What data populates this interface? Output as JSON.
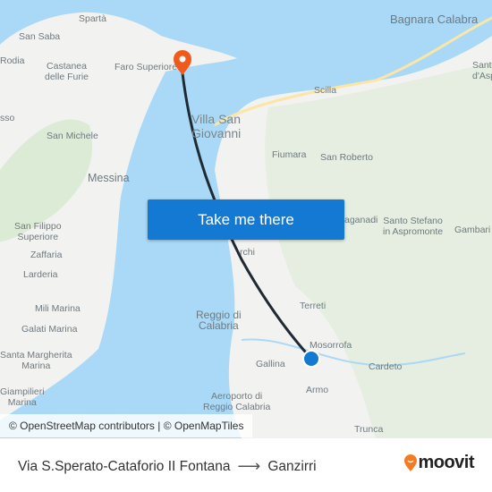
{
  "map": {
    "labels": {
      "sparta": "Spartà",
      "san_saba": "San Saba",
      "rodia": "Rodia",
      "castanea": "Castanea\ndelle Furie",
      "faro": "Faro Superiore",
      "sso": "sso",
      "san_michele": "San Michele",
      "messina": "Messina",
      "villa": "Villa San\nGiovanni",
      "bagnara": "Bagnara Calabra",
      "santa": "Sant\nd'Asp",
      "scilla": "Scilla",
      "fiumara": "Fiumara",
      "san_roberto": "San Roberto",
      "san_filippo": "San Filippo\nSuperiore",
      "zaffaria": "Zaffaria",
      "larderia": "Larderia",
      "mili": "Mili Marina",
      "galati": "Galati Marina",
      "santa_margherita": "Santa Margherita\nMarina",
      "giampilieri": "Giampilieri\nMarina",
      "gambarie": "Gambari",
      "santo_stefano": "Santo Stefano\nin Aspromonte",
      "laganadi": "aganadi",
      "archi": "rchi",
      "terreti": "Terreti",
      "reggio": "Reggio di\nCalabria",
      "mosorrofa": "Mosorrofa",
      "gallina": "Gallina",
      "cardeto": "Cardeto",
      "armo": "Armo",
      "aeroporto": "Aeroporto di\nReggio Calabria",
      "trunca": "Trunca"
    },
    "cta_label": "Take me there",
    "attribution": "© OpenStreetMap contributors | © OpenMapTiles",
    "colors": {
      "sea": "#a9d9f6",
      "land": "#f2f2f0",
      "route": "#1f2a33",
      "destination_pin": "#f05a1a",
      "origin_dot": "#1479d3",
      "button": "#1479d3"
    }
  },
  "footer": {
    "origin": "Via S.Sperato-Cataforio II Fontana",
    "destination": "Ganzirri",
    "brand": "moovit"
  }
}
